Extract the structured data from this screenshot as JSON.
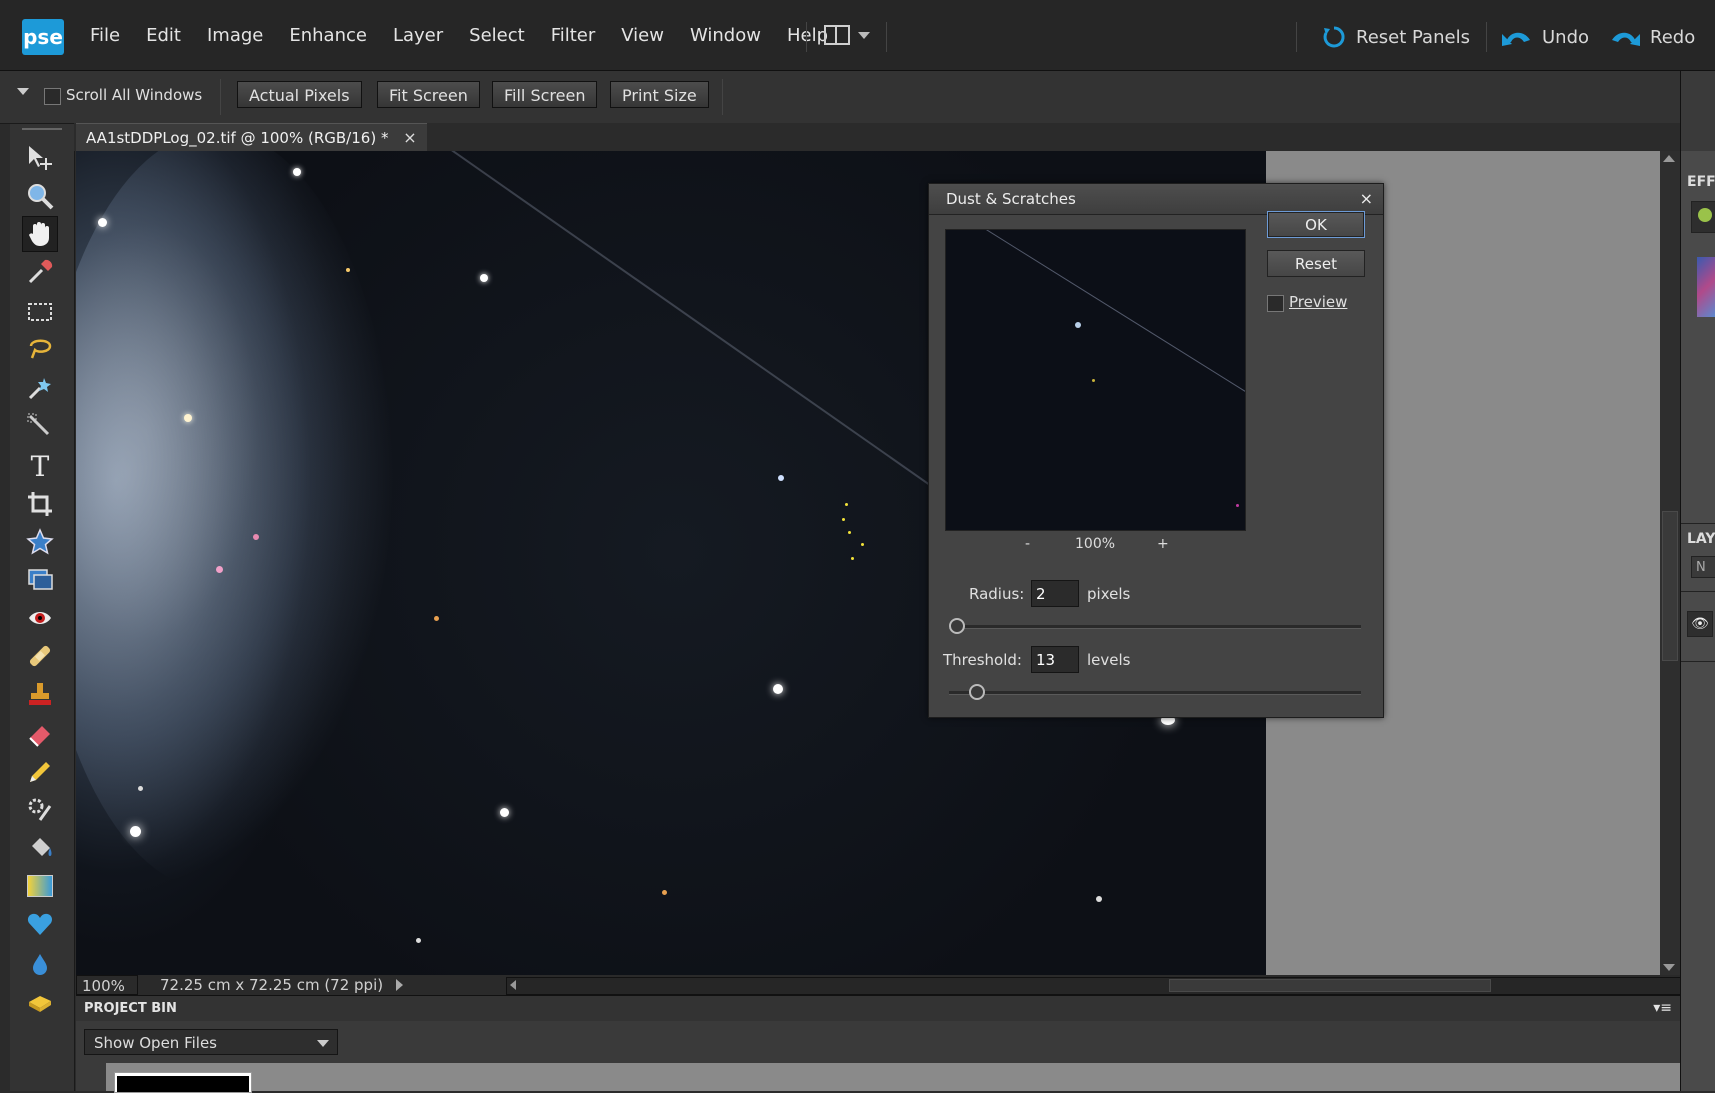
{
  "app": {
    "logo": "pse",
    "menu": [
      "File",
      "Edit",
      "Image",
      "Enhance",
      "Layer",
      "Select",
      "Filter",
      "View",
      "Window",
      "Help"
    ],
    "reset_panels": "Reset Panels",
    "undo": "Undo",
    "redo": "Redo"
  },
  "options_bar": {
    "scroll_all_windows": "Scroll All Windows",
    "scroll_all_windows_checked": false,
    "buttons": [
      "Actual Pixels",
      "Fit Screen",
      "Fill Screen",
      "Print Size"
    ]
  },
  "document": {
    "tab_title": "AA1stDDPLog_02.tif @ 100% (RGB/16) *",
    "tab_close": "×"
  },
  "status_bar": {
    "zoom": "100%",
    "doc_size": "72.25 cm x 72.25 cm (72 ppi)"
  },
  "project_bin": {
    "title": "PROJECT BIN",
    "show": "Show Open Files"
  },
  "right_panel": {
    "effects_abbrev": "EFF",
    "layers_abbrev": "LAY",
    "layer_field": "N"
  },
  "dialog": {
    "title": "Dust & Scratches",
    "close": "×",
    "ok": "OK",
    "reset": "Reset",
    "preview_label": "Preview",
    "preview_checked": false,
    "zoom_minus": "-",
    "zoom_level": "100%",
    "zoom_plus": "+",
    "radius_label": "Radius:",
    "radius_value": "2",
    "radius_unit": "pixels",
    "radius_slider_fraction": 0.0,
    "threshold_label": "Threshold:",
    "threshold_value": "13",
    "threshold_unit": "levels",
    "threshold_slider_fraction": 0.05
  },
  "colors": {
    "accent_blue": "#1d9ad8",
    "menubar_bg": "#262626",
    "panel_bg": "#333333",
    "dialog_bg": "#444444"
  }
}
